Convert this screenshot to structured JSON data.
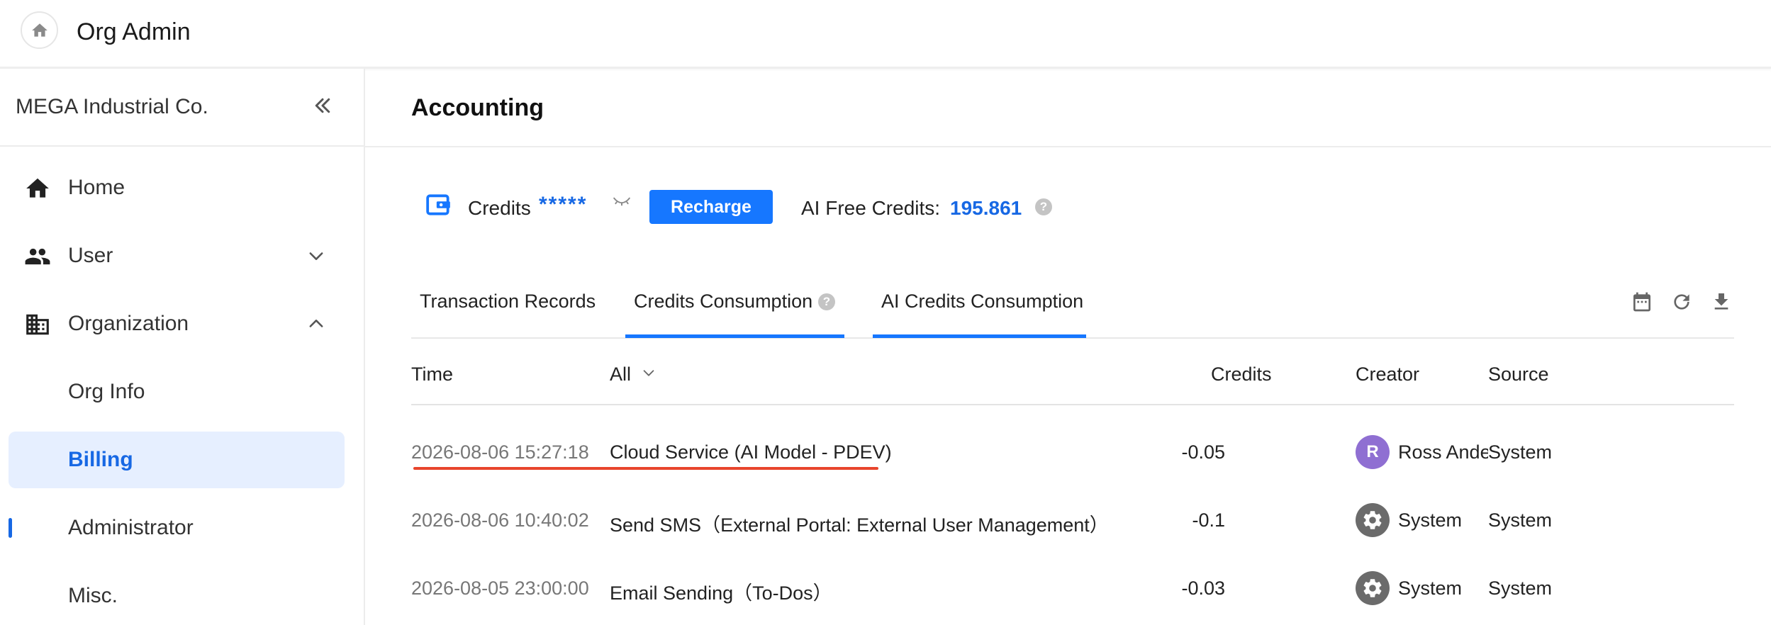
{
  "app": {
    "title": "Org Admin"
  },
  "sidebar": {
    "org_name": "MEGA Industrial Co.",
    "items": [
      {
        "label": "Home"
      },
      {
        "label": "User"
      },
      {
        "label": "Organization"
      },
      {
        "label": "Org Info"
      },
      {
        "label": "Billing"
      },
      {
        "label": "Administrator"
      },
      {
        "label": "Misc."
      }
    ]
  },
  "main": {
    "title": "Accounting",
    "credits_label": "Credits",
    "credits_masked": "*****",
    "recharge_label": "Recharge",
    "free_credits_label": "AI Free Credits:",
    "free_credits_value": "195.861",
    "help_glyph": "?",
    "tabs": [
      {
        "label": "Transaction Records"
      },
      {
        "label": "Credits Consumption"
      },
      {
        "label": "AI Credits Consumption"
      }
    ],
    "table": {
      "headers": {
        "time": "Time",
        "filter": "All",
        "credits": "Credits",
        "creator": "Creator",
        "source": "Source"
      },
      "rows": [
        {
          "time": "2026-08-06 15:27:18",
          "description": "Cloud Service (AI Model - PDEV)",
          "credits": "-0.05",
          "creator_avatar": "R",
          "creator": "Ross Ande",
          "source": "System"
        },
        {
          "time": "2026-08-06 10:40:02",
          "description": "Send SMS（External Portal: External User Management）",
          "credits": "-0.1",
          "creator": "System",
          "source": "System"
        },
        {
          "time": "2026-08-05 23:00:00",
          "description": "Email Sending（To-Dos）",
          "credits": "-0.03",
          "creator": "System",
          "source": "System"
        }
      ]
    }
  },
  "colors": {
    "accent": "#1677ff",
    "active_bg": "#e6efff",
    "annotation": "#e8452c"
  }
}
